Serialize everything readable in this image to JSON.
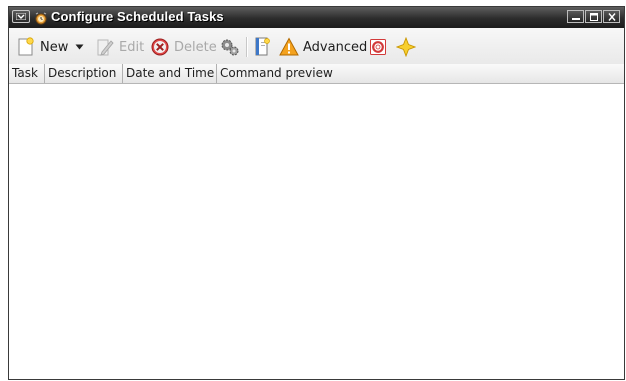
{
  "window": {
    "title": "Configure Scheduled Tasks"
  },
  "toolbar": {
    "new_label": "New",
    "edit_label": "Edit",
    "delete_label": "Delete",
    "advanced_label": "Advanced",
    "icons": {
      "new": "new-document-icon",
      "dropdown": "dropdown-arrow-icon",
      "edit": "edit-pencil-icon",
      "delete": "delete-circle-icon",
      "run": "gears-run-icon",
      "template": "template-book-icon",
      "advanced": "warning-triangle-icon",
      "help": "help-lifebuoy-icon",
      "about": "star-icon"
    }
  },
  "table": {
    "columns": [
      "Task",
      "Description",
      "Date and Time",
      "Command preview"
    ],
    "rows": []
  },
  "colors": {
    "titlebar": "#2c2c2c",
    "warning": "#f0a020",
    "delete": "#cc2222",
    "star": "#f5c518"
  }
}
